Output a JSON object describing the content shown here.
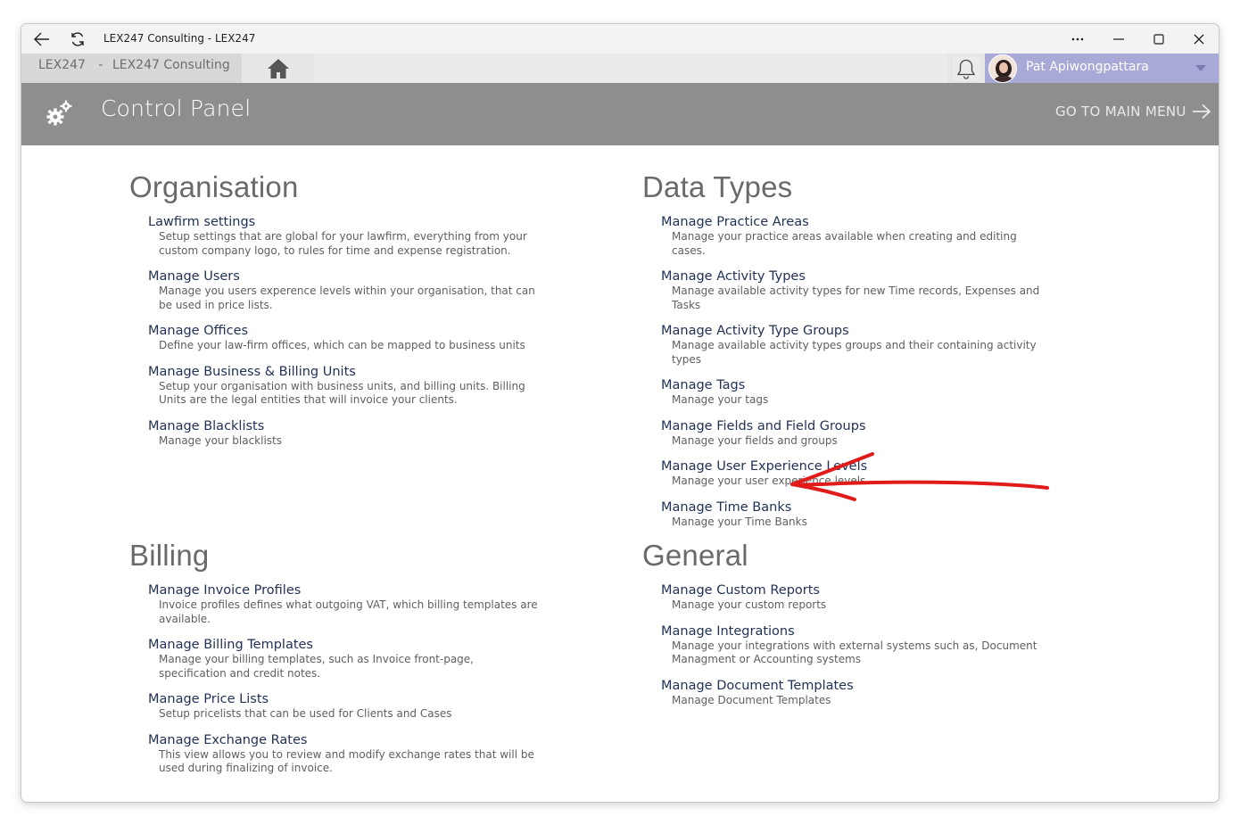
{
  "window": {
    "title": "LEX247 Consulting - LEX247"
  },
  "tabbar": {
    "breadcrumb_app": "LEX247",
    "breadcrumb_sep": "-",
    "breadcrumb_company": "LEX247 Consulting",
    "user_name": "Pat Apiwongpattara"
  },
  "header": {
    "title": "Control Panel",
    "go_main_label": "GO TO MAIN MENU"
  },
  "sections": {
    "organisation": {
      "title": "Organisation",
      "items": [
        {
          "label": "Lawfirm settings",
          "desc": "Setup settings that are global for your lawfirm, everything from your custom company logo, to rules for time and expense registration."
        },
        {
          "label": "Manage Users",
          "desc": "Manage you users experence levels within your organisation, that can be used in price lists."
        },
        {
          "label": "Manage Offices",
          "desc": "Define your law-firm offices, which can be mapped to business units"
        },
        {
          "label": "Manage Business & Billing Units",
          "desc": "Setup your organisation with business units, and billing units. Billing Units are the legal entities that will invoice your clients."
        },
        {
          "label": "Manage Blacklists",
          "desc": "Manage your blacklists"
        }
      ]
    },
    "data_types": {
      "title": "Data Types",
      "items": [
        {
          "label": "Manage Practice Areas",
          "desc": "Manage your practice areas available when creating and editing cases."
        },
        {
          "label": "Manage Activity Types",
          "desc": "Manage available activity types for new Time records, Expenses and Tasks"
        },
        {
          "label": "Manage Activity Type Groups",
          "desc": "Manage available activity types groups and their containing activity types"
        },
        {
          "label": "Manage Tags",
          "desc": "Manage your tags"
        },
        {
          "label": "Manage Fields and Field Groups",
          "desc": "Manage your fields and groups"
        },
        {
          "label": "Manage User Experience Levels",
          "desc": "Manage your user experience levels"
        },
        {
          "label": "Manage Time Banks",
          "desc": "Manage your Time Banks"
        }
      ]
    },
    "billing": {
      "title": "Billing",
      "items": [
        {
          "label": "Manage Invoice Profiles",
          "desc": "Invoice profiles defines what outgoing VAT, which billing templates are available."
        },
        {
          "label": "Manage Billing Templates",
          "desc": "Manage your billing templates, such as Invoice front-page, specification and credit notes."
        },
        {
          "label": "Manage Price Lists",
          "desc": "Setup pricelists that can be used for Clients and Cases"
        },
        {
          "label": "Manage Exchange Rates",
          "desc": "This view allows you to review and modify exchange rates that will be used during finalizing of invoice."
        }
      ]
    },
    "general": {
      "title": "General",
      "items": [
        {
          "label": "Manage Custom Reports",
          "desc": "Manage your custom reports"
        },
        {
          "label": "Manage Integrations",
          "desc": "Manage your integrations with external systems such as, Document Managment or Accounting systems"
        },
        {
          "label": "Manage Document Templates",
          "desc": "Manage Document Templates"
        }
      ]
    }
  },
  "colors": {
    "header_bg": "#8e8e8e",
    "user_area_bg": "#a8a9d6",
    "link": "#223255",
    "annotation_arrow": "#e11a1a"
  },
  "icons": [
    "back-arrow-icon",
    "refresh-icon",
    "more-icon",
    "minimize-icon",
    "maximize-icon",
    "close-icon",
    "home-icon",
    "bell-icon",
    "avatar",
    "caret-down-icon",
    "gears-icon",
    "arrow-right-icon"
  ]
}
